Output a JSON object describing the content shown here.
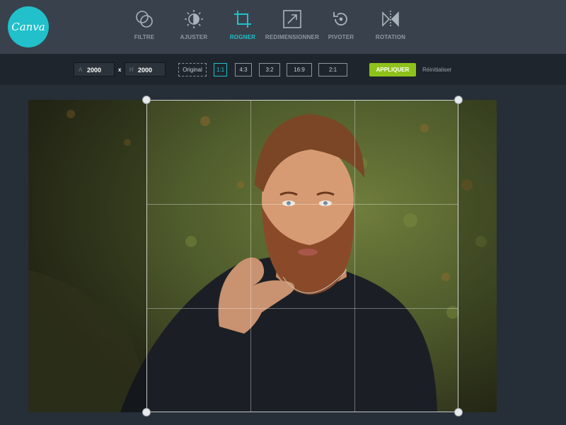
{
  "app": {
    "logo_text": "Canva",
    "brand_color": "#21c0cb"
  },
  "tools": [
    {
      "label": "FILTRE",
      "icon": "filter-icon"
    },
    {
      "label": "AJUSTER",
      "icon": "adjust-icon"
    },
    {
      "label": "ROGNER",
      "icon": "crop-icon",
      "active": true
    },
    {
      "label": "REDIMENSIONNER",
      "icon": "resize-icon"
    },
    {
      "label": "PIVOTER",
      "icon": "rotate-icon"
    },
    {
      "label": "ROTATION",
      "icon": "flip-icon"
    }
  ],
  "crop_options": {
    "width_prefix": "A",
    "width_value": "2000",
    "times": "x",
    "height_prefix": "H",
    "height_value": "2000",
    "ratios": [
      "Original",
      "1:1",
      "4:3",
      "3:2",
      "16:9",
      "2:1"
    ],
    "selected_ratio": "1:1",
    "apply_label": "APPLIQUER",
    "reset_label": "Réinitialiser",
    "apply_color": "#8ec21b"
  }
}
